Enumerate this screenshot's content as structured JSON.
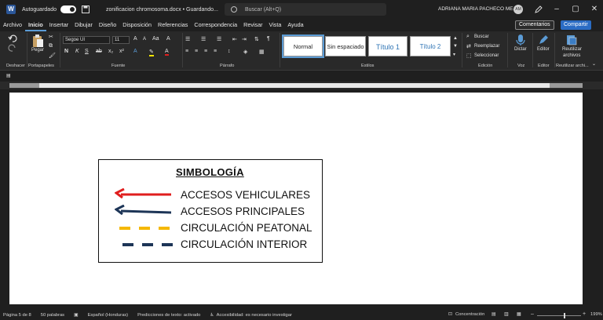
{
  "titlebar": {
    "autosave_label": "Autoguardado",
    "doc_title": "zonificacion chromosoma.docx • Guardando...",
    "search_placeholder": "Buscar (Alt+Q)",
    "user_name": "ADRIANA MARIA PACHECO MEJIA",
    "user_initials": "AM",
    "logo_letter": "W"
  },
  "menu": {
    "items": [
      "Archivo",
      "Inicio",
      "Insertar",
      "Dibujar",
      "Diseño",
      "Disposición",
      "Referencias",
      "Correspondencia",
      "Revisar",
      "Vista",
      "Ayuda"
    ],
    "comments_label": "Comentarios",
    "share_label": "Compartir"
  },
  "ribbon": {
    "undo_label": "Deshacer",
    "clipboard_label": "Portapapeles",
    "paste_label": "Pegar",
    "font_label": "Fuente",
    "font_name": "Segoe UI",
    "font_size": "11",
    "paragraph_label": "Párrafo",
    "styles_label": "Estilos",
    "styles": [
      "Normal",
      "Sin espaciado",
      "Título 1",
      "Título 2"
    ],
    "edit_label": "Edición",
    "find_label": "Buscar",
    "replace_label": "Reemplazar",
    "select_label": "Seleccionar",
    "voice_label": "Voz",
    "dictate_label": "Dictar",
    "editor_group_label": "Editor",
    "editor_label": "Editor",
    "reuse_group_label": "Reutilizar archi...",
    "reuse_label_1": "Reutilizar",
    "reuse_label_2": "archivos"
  },
  "document": {
    "legend_title": "SIMBOLOGÍA",
    "legend_items": [
      {
        "label": "ACCESOS VEHICULARES",
        "color": "#e01e1e",
        "style": "arrow"
      },
      {
        "label": "ACCESOS PRINCIPALES",
        "color": "#1d3557",
        "style": "arrow"
      },
      {
        "label": "CIRCULACIÓN PEATONAL",
        "color": "#f5b800",
        "style": "dashed"
      },
      {
        "label": "CIRCULACIÓN INTERIOR",
        "color": "#1d3557",
        "style": "dashed"
      }
    ]
  },
  "status": {
    "page": "Página 5 de 8",
    "words": "50 palabras",
    "language": "Español (Honduras)",
    "predictions": "Predicciones de texto: activado",
    "accessibility": "Accesibilidad: es necesario investigar",
    "focus": "Concentración",
    "zoom": "199%"
  },
  "colors": {
    "accent": "#2b6cc4",
    "background": "#1f1f1f"
  }
}
